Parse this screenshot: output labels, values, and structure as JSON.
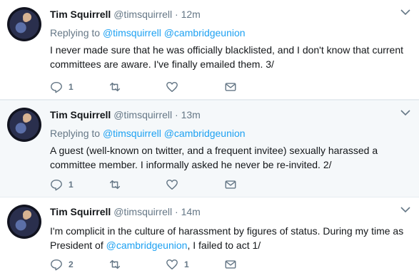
{
  "tweets": [
    {
      "name": "Tim Squirrell",
      "handle": "@timsquirrell",
      "dot": "·",
      "time": "12m",
      "replying_prefix": "Replying to ",
      "replying_to": [
        "@timsquirrell",
        "@cambridgeunion"
      ],
      "text": "I never made sure that he was officially blacklisted, and I don't know that current committees are aware. I've finally emailed them. 3/",
      "counts": {
        "reply": "1",
        "retweet": "",
        "like": ""
      }
    },
    {
      "name": "Tim Squirrell",
      "handle": "@timsquirrell",
      "dot": "·",
      "time": "13m",
      "replying_prefix": "Replying to ",
      "replying_to": [
        "@timsquirrell",
        "@cambridgeunion"
      ],
      "text": "A guest (well-known on twitter, and a frequent invitee) sexually harassed a committee member. I informally asked he never be re-invited. 2/",
      "counts": {
        "reply": "1",
        "retweet": "",
        "like": ""
      }
    },
    {
      "name": "Tim Squirrell",
      "handle": "@timsquirrell",
      "dot": "·",
      "time": "14m",
      "text_before": "I'm complicit in the culture of harassment by figures of status. During my time as President of ",
      "text_link": "@cambridgeunion",
      "text_after": ", I failed to act 1/",
      "counts": {
        "reply": "2",
        "retweet": "",
        "like": "1"
      }
    }
  ],
  "icons": {
    "reply": "reply-icon",
    "retweet": "retweet-icon",
    "like": "heart-icon",
    "dm": "direct-message-icon",
    "caret": "chevron-down-icon"
  },
  "colors": {
    "link": "#1da1f2",
    "muted": "#657786",
    "text": "#14171a"
  }
}
